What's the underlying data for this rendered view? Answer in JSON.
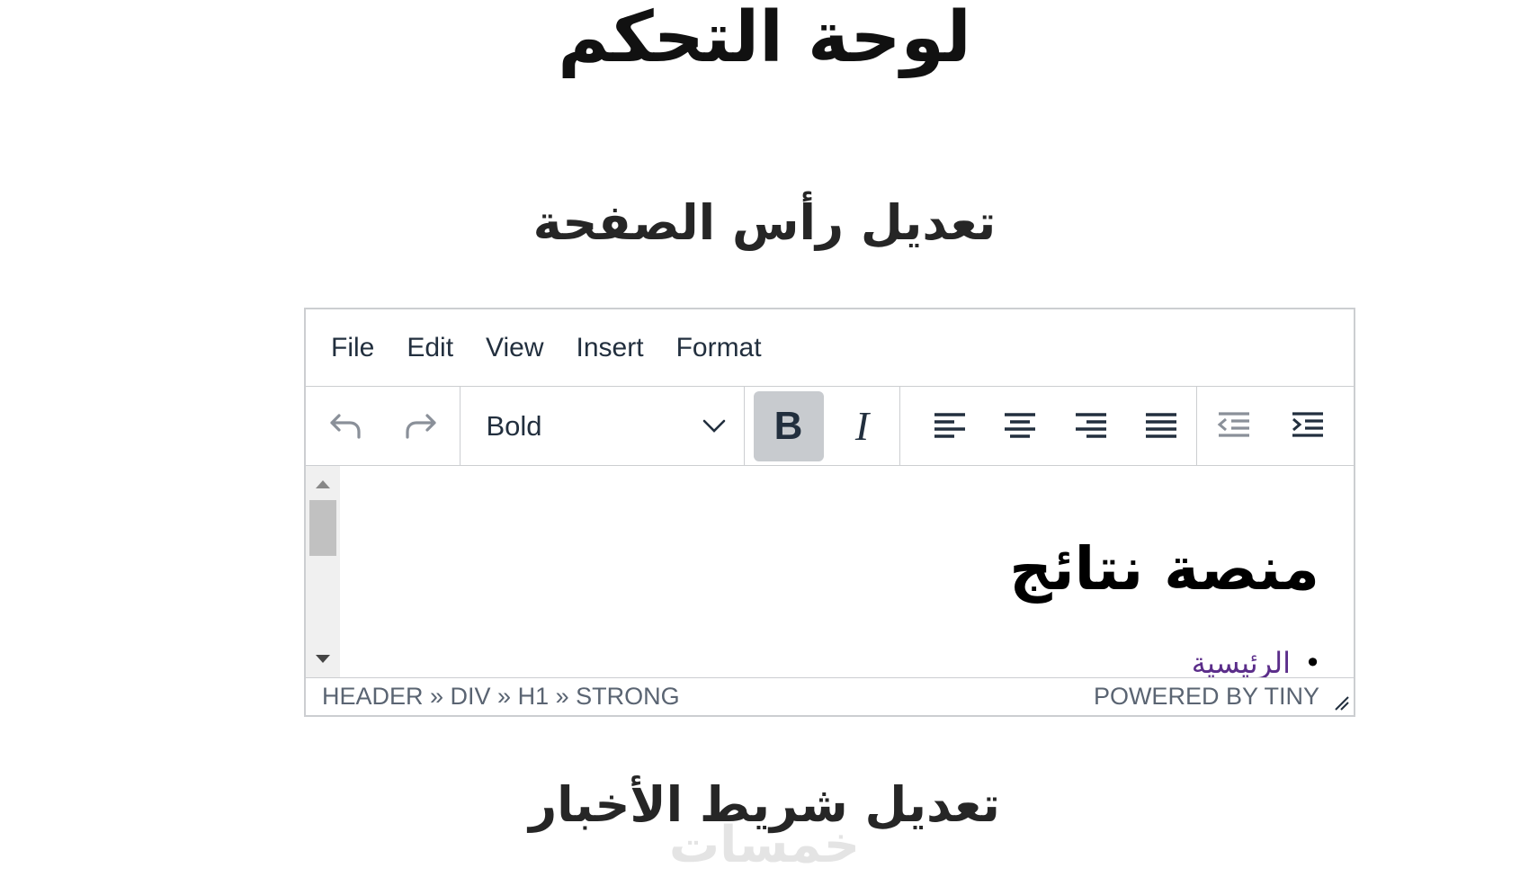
{
  "page": {
    "title": "لوحة التحكم",
    "section1_title": "تعديل رأس الصفحة",
    "section2_title": "تعديل شريط الأخبار",
    "watermark": "خمسات"
  },
  "editor": {
    "menu": [
      "File",
      "Edit",
      "View",
      "Insert",
      "Format"
    ],
    "block_format": "Bold",
    "bold_label": "B",
    "italic_label": "I",
    "content": {
      "heading": "منصة نتائج",
      "list_items": [
        "الرئيسية"
      ]
    },
    "status": {
      "path": [
        "HEADER",
        "DIV",
        "H1",
        "STRONG"
      ],
      "path_display": "HEADER » DIV » H1 » STRONG",
      "branding": "POWERED BY TINY"
    }
  },
  "colors": {
    "text": "#222f3e",
    "border": "#ccced1",
    "active_button": "#c8cbcf",
    "link": "#5b2d8a"
  }
}
